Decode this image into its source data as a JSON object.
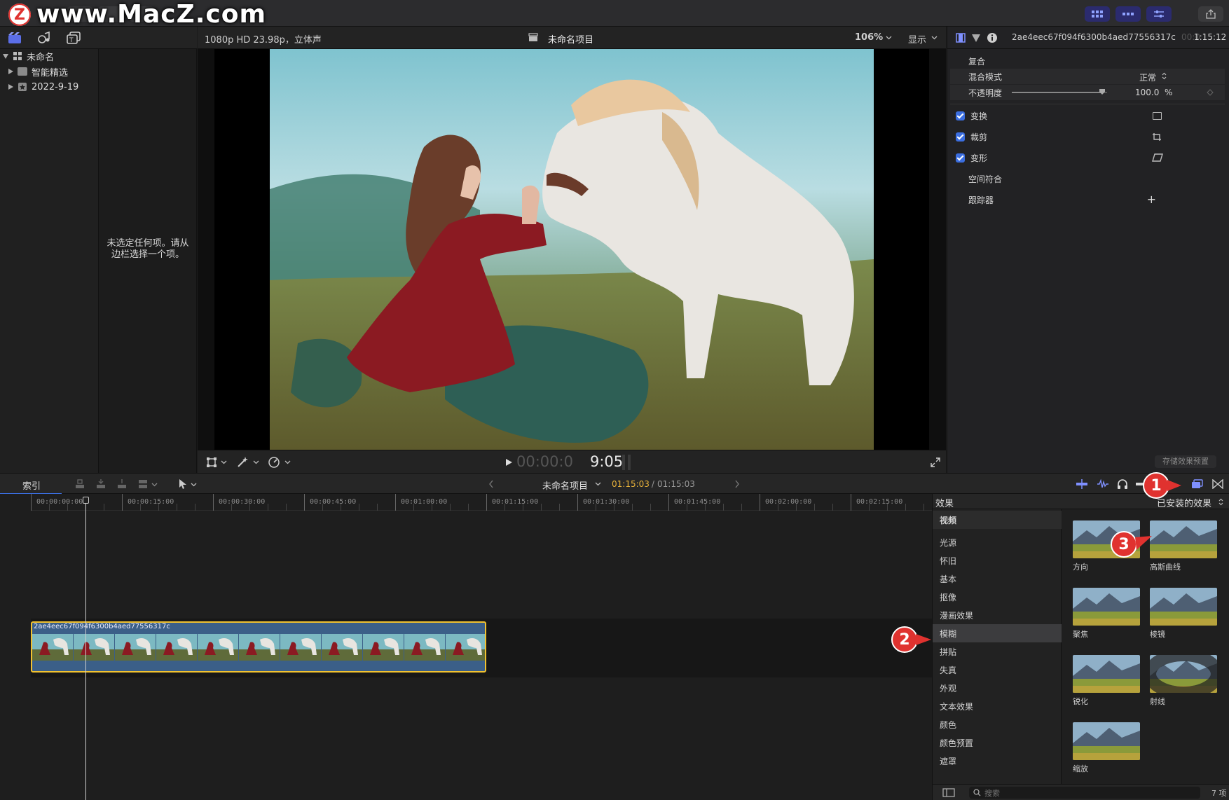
{
  "watermark": {
    "logo": "Z",
    "text": "www.MacZ.com"
  },
  "library": {
    "items": [
      {
        "label": "未命名",
        "icon": "library-grid-icon",
        "expanded": true
      },
      {
        "label": "智能精选",
        "icon": "folder-icon",
        "expanded": false
      },
      {
        "label": "2022-9-19",
        "icon": "event-icon",
        "expanded": false
      }
    ],
    "browser_empty": "未选定任何项。请从边栏选择一个项。"
  },
  "viewer": {
    "format": "1080p HD 23.98p，立体声",
    "project": "未命名项目",
    "zoom": "106%",
    "display": "显示",
    "timecode_dim": "00:00:0",
    "timecode_bright": "9:05"
  },
  "inspector": {
    "clip_name": "2ae4eec67f094f6300b4aed77556317c",
    "duration_dim": "00:0",
    "duration": "1:15:12",
    "section": "复合",
    "blend_label": "混合模式",
    "blend_value": "正常",
    "opacity_label": "不透明度",
    "opacity_value": "100.0",
    "opacity_unit": "%",
    "opacity_fraction": 0.95,
    "rows": [
      {
        "label": "变换",
        "checked": true,
        "icon": "transform-icon"
      },
      {
        "label": "裁剪",
        "checked": true,
        "icon": "crop-icon"
      },
      {
        "label": "变形",
        "checked": true,
        "icon": "distort-icon"
      },
      {
        "label": "空间符合",
        "checked": false,
        "icon": ""
      },
      {
        "label": "跟踪器",
        "checked": false,
        "icon": "plus-icon"
      }
    ],
    "save_preset": "存储效果预置"
  },
  "timeline_bar": {
    "index": "索引",
    "project": "未命名项目",
    "timecode_current": "01:15:03",
    "timecode_sep": " / ",
    "timecode_total": "01:15:03"
  },
  "ruler": [
    "00:00:00:00",
    "00:00:15:00",
    "00:00:30:00",
    "00:00:45:00",
    "00:01:00:00",
    "00:01:15:00",
    "00:01:30:00",
    "00:01:45:00",
    "00:02:00:00",
    "00:02:15:00"
  ],
  "clip": {
    "name": "2ae4eec67f094f6300b4aed77556317c"
  },
  "effects": {
    "title": "效果",
    "filter": "已安装的效果",
    "categories": [
      "视频",
      "光源",
      "怀旧",
      "基本",
      "抠像",
      "漫画效果",
      "模糊",
      "拼贴",
      "失真",
      "外观",
      "文本效果",
      "颜色",
      "颜色预置",
      "遮罩"
    ],
    "selected": "模糊",
    "items": [
      "方向",
      "高斯曲线",
      "聚焦",
      "棱镜",
      "锐化",
      "射线",
      "缩放"
    ],
    "search_placeholder": "搜索",
    "count": "7 项"
  },
  "callouts": [
    "1",
    "2",
    "3"
  ],
  "colors": {
    "accent": "#3b6ee0",
    "clip_border": "#f2c230",
    "callout": "#e0322f",
    "timecode_yellow": "#e8b23a"
  }
}
